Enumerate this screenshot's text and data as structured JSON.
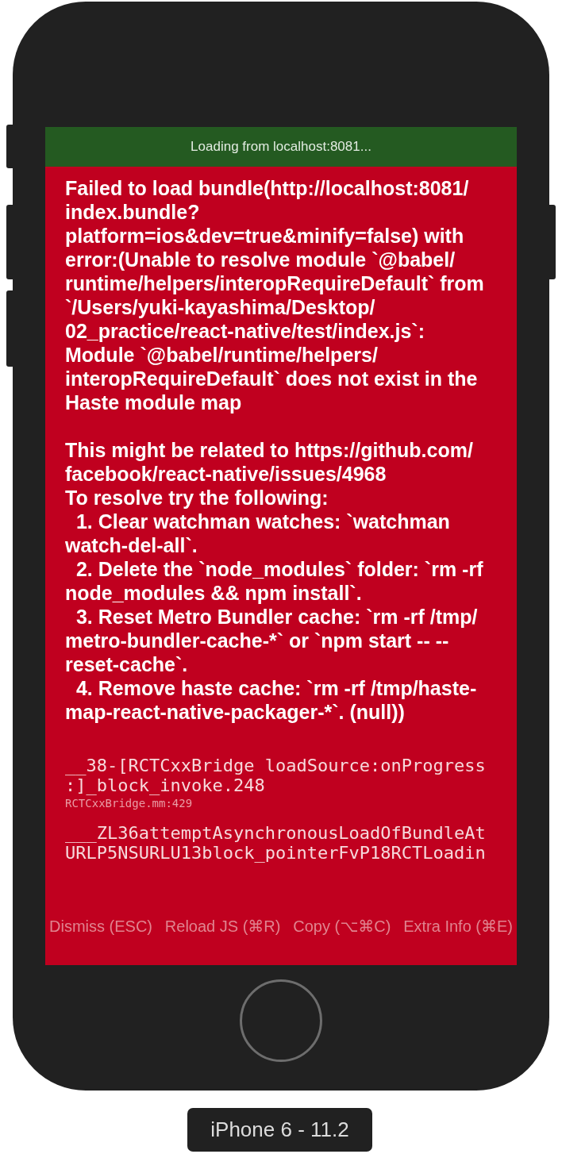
{
  "loading_bar": {
    "text": "Loading from localhost:8081..."
  },
  "error": {
    "paragraphs": [
      "Failed to load bundle(http://localhost:8081/\nindex.bundle?\nplatform=ios&dev=true&minify=false) with\nerror:(Unable to resolve module `@babel/\nruntime/helpers/interopRequireDefault` from\n`/Users/yuki-kayashima/Desktop/\n02_practice/react-native/test/index.js`:\nModule `@babel/runtime/helpers/\ninteropRequireDefault` does not exist in the\nHaste module map",
      "This might be related to https://github.com/\nfacebook/react-native/issues/4968\nTo resolve try the following:\n  1. Clear watchman watches: `watchman\nwatch-del-all`.\n  2. Delete the `node_modules` folder: `rm -rf\nnode_modules && npm install`.\n  3. Reset Metro Bundler cache: `rm -rf /tmp/\nmetro-bundler-cache-*` or `npm start -- --\nreset-cache`.\n  4. Remove haste cache: `rm -rf /tmp/haste-\nmap-react-native-packager-*`. (null))"
    ],
    "stack": [
      {
        "method": "__38-[RCTCxxBridge loadSource:onProgress:]_block_invoke.248",
        "file": "RCTCxxBridge.mm:429"
      },
      {
        "method": "___ZL36attemptAsynchronousLoadOfBundleAtURLP5NSURLU13block_pointerFvP18RCTLoadin"
      }
    ]
  },
  "buttons": [
    "Dismiss (ESC)",
    "Reload JS (⌘R)",
    "Copy (⌥⌘C)",
    "Extra Info (⌘E)"
  ],
  "device": {
    "label": "iPhone 6 - 11.2"
  }
}
